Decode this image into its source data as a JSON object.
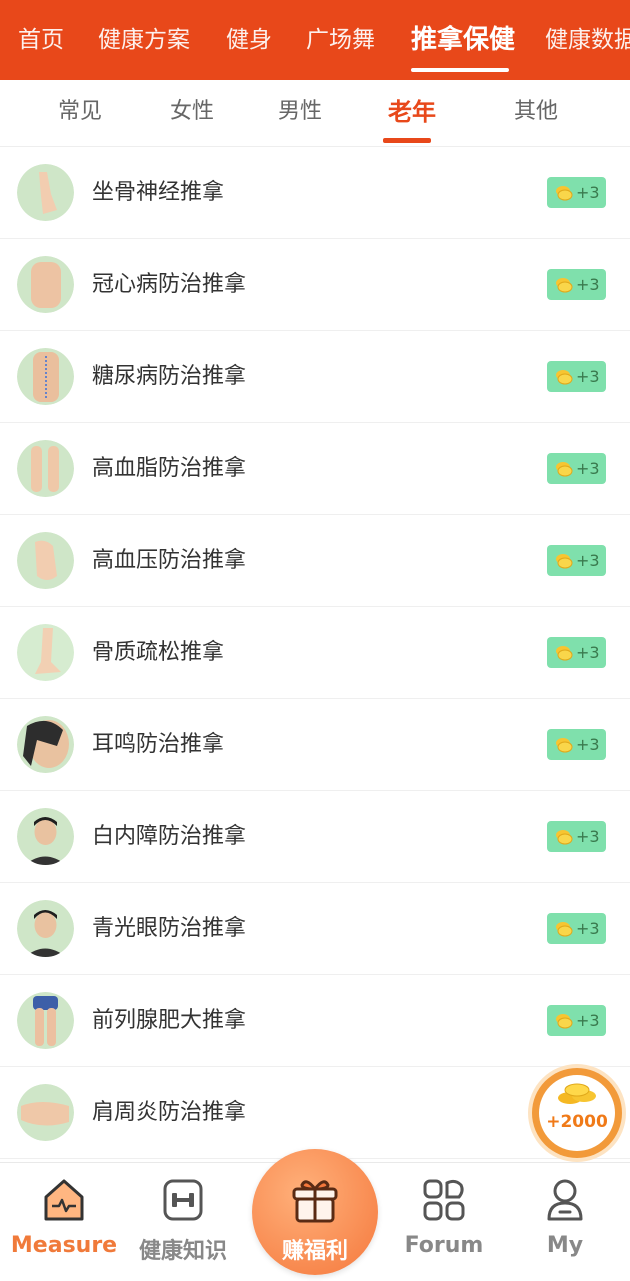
{
  "categories": [
    {
      "label": "首页",
      "active": false
    },
    {
      "label": "健康方案",
      "active": false
    },
    {
      "label": "健身",
      "active": false
    },
    {
      "label": "广场舞",
      "active": false
    },
    {
      "label": "推拿保健",
      "active": true
    },
    {
      "label": "健康数据",
      "active": false
    }
  ],
  "subtabs": [
    {
      "label": "常见",
      "active": false
    },
    {
      "label": "女性",
      "active": false
    },
    {
      "label": "男性",
      "active": false
    },
    {
      "label": "老年",
      "active": true
    },
    {
      "label": "其他",
      "active": false
    }
  ],
  "items": [
    {
      "label": "坐骨神经推拿",
      "reward": "+3"
    },
    {
      "label": "冠心病防治推拿",
      "reward": "+3"
    },
    {
      "label": "糖尿病防治推拿",
      "reward": "+3"
    },
    {
      "label": "高血脂防治推拿",
      "reward": "+3"
    },
    {
      "label": "高血压防治推拿",
      "reward": "+3"
    },
    {
      "label": "骨质疏松推拿",
      "reward": "+3"
    },
    {
      "label": "耳鸣防治推拿",
      "reward": "+3"
    },
    {
      "label": "白内障防治推拿",
      "reward": "+3"
    },
    {
      "label": "青光眼防治推拿",
      "reward": "+3"
    },
    {
      "label": "前列腺肥大推拿",
      "reward": "+3"
    },
    {
      "label": "肩周炎防治推拿",
      "reward": ""
    }
  ],
  "bonus": {
    "label": "+2000"
  },
  "bottom_nav": {
    "measure": "Measure",
    "knowledge": "健康知识",
    "welfare": "赚福利",
    "forum": "Forum",
    "my": "My"
  },
  "colors": {
    "brand": "#e8481a",
    "accent": "#f07a3a",
    "reward_bg": "#7fe0ac"
  }
}
